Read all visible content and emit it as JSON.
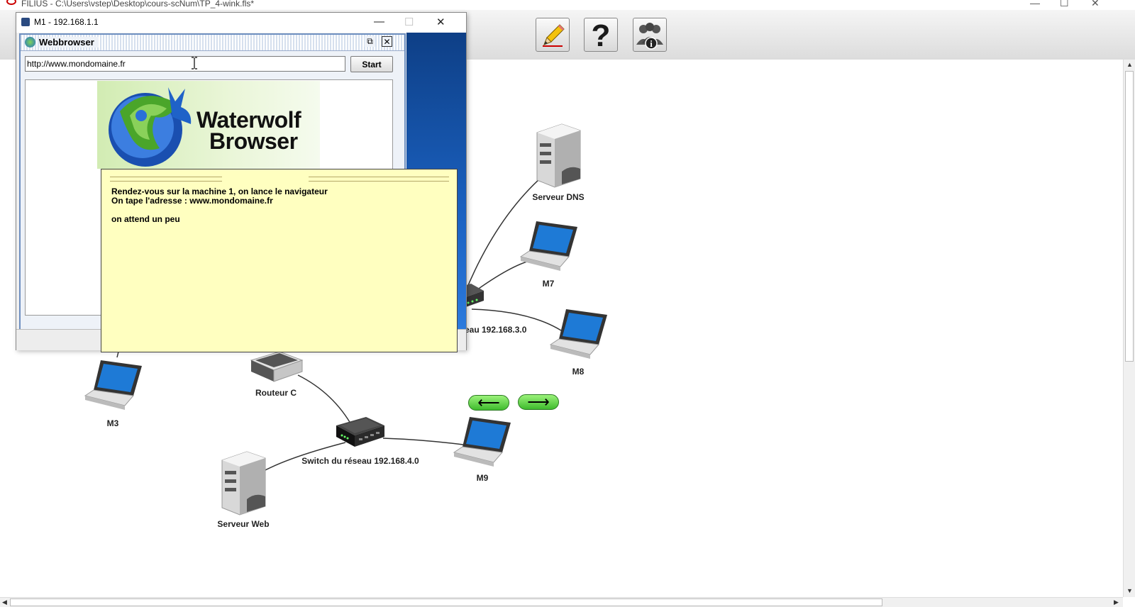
{
  "app": {
    "title": "FILIUS - C:\\Users\\vstep\\Desktop\\cours-scNum\\TP_4-wink.fls*"
  },
  "toolbar": {
    "buttons": [
      {
        "name": "design-mode",
        "icon": "pencil-icon"
      },
      {
        "name": "help",
        "icon": "question-mark-icon"
      },
      {
        "name": "about",
        "icon": "users-info-icon"
      }
    ]
  },
  "m1_window": {
    "title": "M1 - 192.168.1.1"
  },
  "webbrowser": {
    "title": "Webbrowser",
    "url": "http://www.mondomaine.fr",
    "start_label": "Start",
    "banner_line1": "Waterwolf",
    "banner_line2": "Browser"
  },
  "note": {
    "line1": "Rendez-vous sur la machine 1, on lance le navigateur",
    "line2": "On tape l'adresse : www.mondomaine.fr",
    "line3": "on attend un peu"
  },
  "network": {
    "dns_server": "Serveur DNS",
    "m7": "M7",
    "switch_3": "...éseau 192.168.3.0",
    "m8": "M8",
    "m3": "M3",
    "router_c": "Routeur C",
    "switch_4": "Switch du réseau 192.168.4.0",
    "m9": "M9",
    "web_server": "Serveur Web"
  },
  "colors": {
    "note_bg": "#ffffc0",
    "nav_green": "#3fbb2d",
    "titlebar_blue": "#1b62c2"
  }
}
